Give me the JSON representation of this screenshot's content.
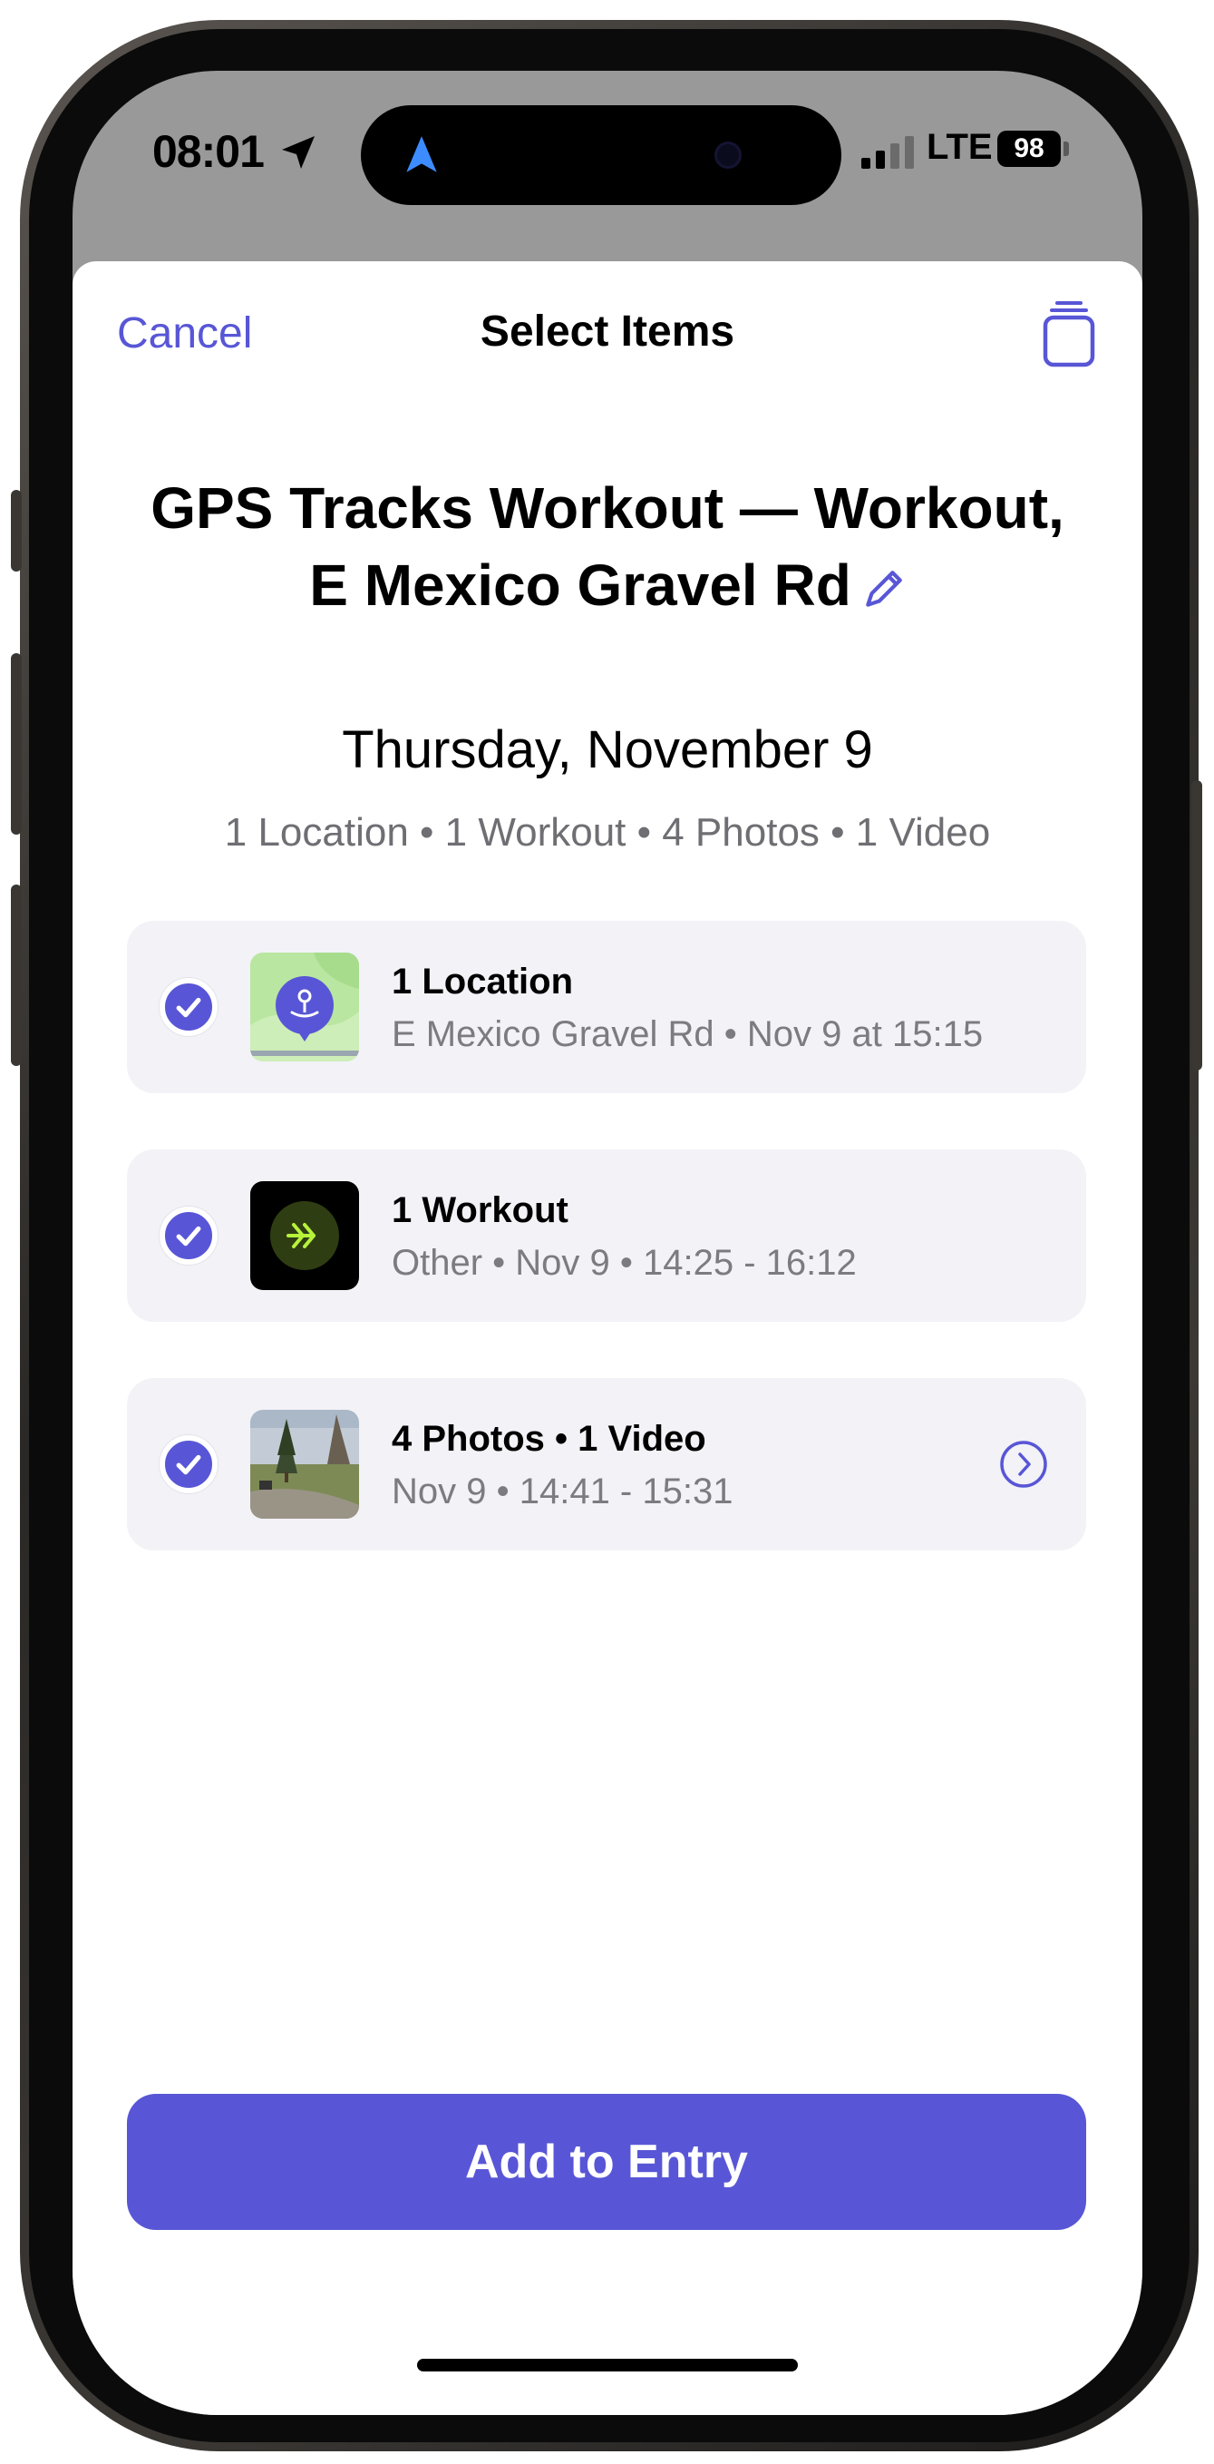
{
  "status_bar": {
    "time": "08:01",
    "network": "LTE",
    "battery": "98"
  },
  "nav": {
    "cancel_label": "Cancel",
    "title": "Select Items"
  },
  "entry": {
    "title": "GPS Tracks Workout — Workout, E Mexico Gravel Rd",
    "date": "Thursday, November 9",
    "summary": "1 Location • 1 Workout • 4 Photos • 1 Video"
  },
  "items": [
    {
      "title": "1 Location",
      "subtitle": "E Mexico Gravel Rd • Nov 9 at 15:15",
      "icon": "map-pin-icon",
      "selected": true
    },
    {
      "title": "1 Workout",
      "subtitle": "Other • Nov 9 • 14:25 - 16:12",
      "icon": "workout-icon",
      "selected": true
    },
    {
      "title": "4 Photos • 1 Video",
      "subtitle": "Nov 9 • 14:41 - 15:31",
      "icon": "photo-thumbnail",
      "selected": true
    }
  ],
  "action": {
    "add_label": "Add to Entry"
  },
  "colors": {
    "accent": "#5856d6",
    "card_bg": "#f2f2f7",
    "secondary_text": "#7c7c80",
    "workout_green": "#b6f23c"
  }
}
